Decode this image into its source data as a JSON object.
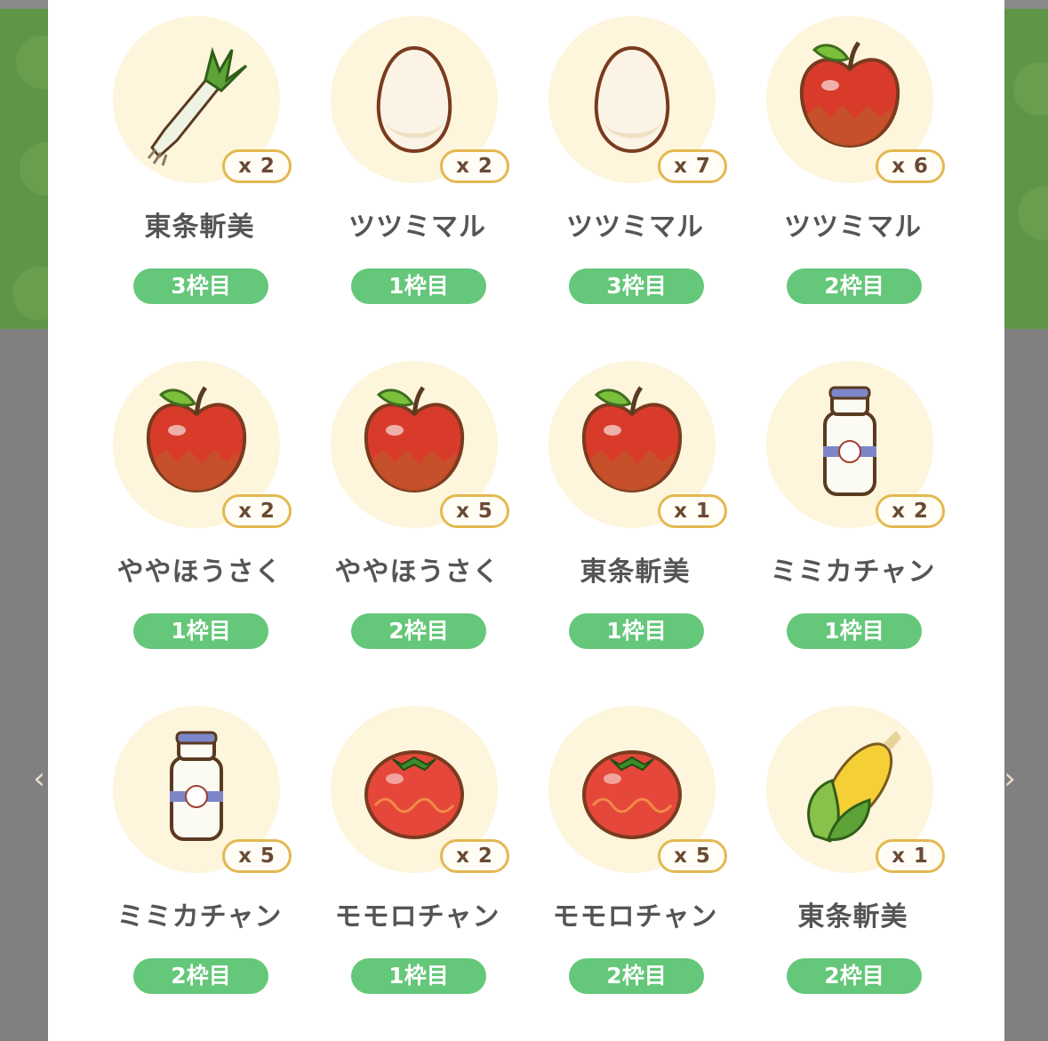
{
  "items": [
    {
      "food": "leek",
      "qty": "x 2",
      "name": "東条斬美",
      "slot": "3枠目"
    },
    {
      "food": "egg",
      "qty": "x 2",
      "name": "ツツミマル",
      "slot": "1枠目"
    },
    {
      "food": "egg",
      "qty": "x 7",
      "name": "ツツミマル",
      "slot": "3枠目"
    },
    {
      "food": "apple",
      "qty": "x 6",
      "name": "ツツミマル",
      "slot": "2枠目"
    },
    {
      "food": "apple",
      "qty": "x 2",
      "name": "ややほうさく",
      "slot": "1枠目"
    },
    {
      "food": "apple",
      "qty": "x 5",
      "name": "ややほうさく",
      "slot": "2枠目"
    },
    {
      "food": "apple",
      "qty": "x 1",
      "name": "東条斬美",
      "slot": "1枠目"
    },
    {
      "food": "milk",
      "qty": "x 2",
      "name": "ミミカチャン",
      "slot": "1枠目"
    },
    {
      "food": "milk",
      "qty": "x 5",
      "name": "ミミカチャン",
      "slot": "2枠目"
    },
    {
      "food": "tomato",
      "qty": "x 2",
      "name": "モモロチャン",
      "slot": "1枠目"
    },
    {
      "food": "tomato",
      "qty": "x 5",
      "name": "モモロチャン",
      "slot": "2枠目"
    },
    {
      "food": "corn",
      "qty": "x 1",
      "name": "東条斬美",
      "slot": "2枠目"
    }
  ],
  "nav": {
    "prev_icon": "chevron-left-icon",
    "next_icon": "chevron-right-icon"
  },
  "colors": {
    "slot_badge": "#64c779",
    "qty_border": "#e3b850",
    "circle": "#fdf5dc",
    "background_green": "#5f9547"
  }
}
